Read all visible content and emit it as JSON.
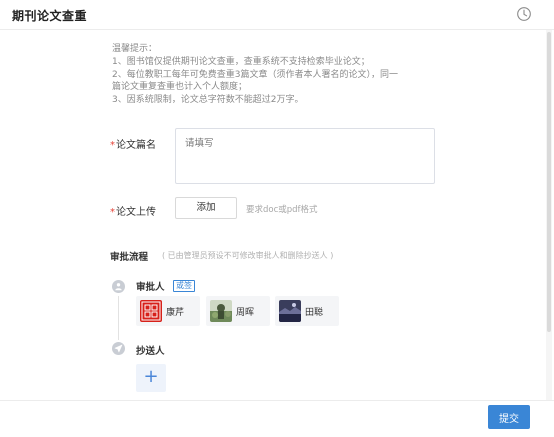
{
  "header": {
    "title": "期刊论文查重",
    "icon": "history-clock-icon"
  },
  "tips": {
    "line1": "温馨提示：",
    "line2": "1、图书馆仅提供期刊论文查重，查重系统不支持检索毕业论文；",
    "line3": "2、每位教职工每年可免费查重3篇文章（须作者本人署名的论文），同一",
    "line4": "篇论文重复查重也计入个人额度；",
    "line5": "3、因系统限制，论文总字符数不能超过2万字。"
  },
  "form": {
    "required_mark": "*",
    "title_label": "论文篇名",
    "title_placeholder": "请填写",
    "upload_label": "论文上传",
    "add_label": "添加",
    "upload_hint": "要求doc或pdf格式"
  },
  "approval": {
    "title": "审批流程",
    "note": "( 已由管理员预设不可修改审批人和删除抄送人 )",
    "approver_label": "审批人",
    "or_sign_tag": "或签",
    "approvers": [
      {
        "name": "康芹"
      },
      {
        "name": "周晖"
      },
      {
        "name": "田聪"
      }
    ],
    "cc_label": "抄送人",
    "add_cc_symbol": "+"
  },
  "footer": {
    "submit_label": "提交"
  },
  "colors": {
    "accent": "#3a86d6",
    "required": "#e6453a"
  }
}
